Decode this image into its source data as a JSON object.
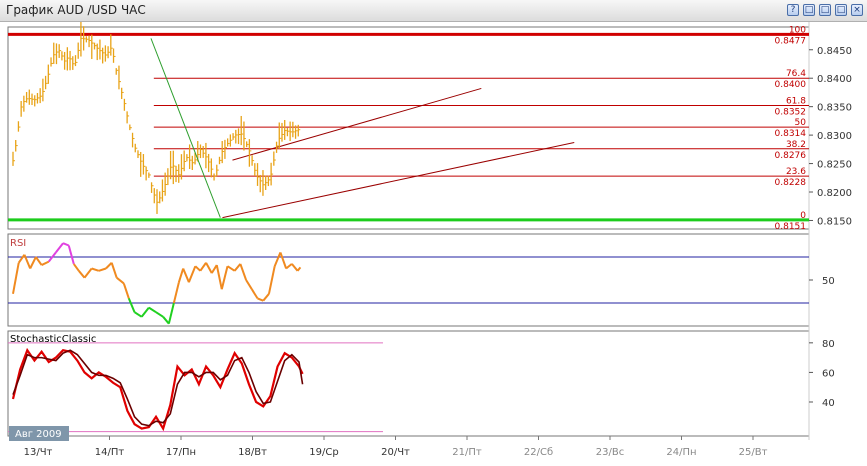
{
  "window": {
    "title": "График AUD /USD  ЧАС",
    "buttons": [
      "?",
      "□",
      "□",
      "□",
      "×"
    ]
  },
  "colors": {
    "price": "#e8a317",
    "fib": "#c00000",
    "channel": "#9a0000",
    "trend": "#2a9d2a",
    "rsi": "#f08a20",
    "rsi_high": "#e040e0",
    "rsi_low": "#20d020",
    "stoch_k": "#e00000",
    "stoch_d": "#6a0000",
    "bands": "#e070c0",
    "rsi_lines": "#2020a0"
  },
  "chart_data": [
    {
      "type": "line",
      "panel": "price",
      "series_style": "bars",
      "y_ticks": [
        "0.8450",
        "0.8400",
        "0.8350",
        "0.8300",
        "0.8250",
        "0.8200",
        "0.8150"
      ],
      "ylim": [
        0.8135,
        0.849
      ],
      "x_tick_labels": [
        "13/Чт",
        "14/Пт",
        "17/Пн",
        "18/Вт",
        "19/Ср",
        "20/Чт",
        "21/Пт",
        "22/Сб",
        "23/Вс",
        "24/Пн",
        "25/Вт"
      ],
      "x_future_from": 6,
      "price_path": [
        [
          0,
          0.8255
        ],
        [
          0.05,
          0.829
        ],
        [
          0.12,
          0.8355
        ],
        [
          0.2,
          0.8365
        ],
        [
          0.3,
          0.8362
        ],
        [
          0.4,
          0.837
        ],
        [
          0.48,
          0.84
        ],
        [
          0.56,
          0.844
        ],
        [
          0.64,
          0.845
        ],
        [
          0.72,
          0.843
        ],
        [
          0.78,
          0.8438
        ],
        [
          0.86,
          0.842
        ],
        [
          0.95,
          0.847
        ],
        [
          1.05,
          0.8468
        ],
        [
          1.2,
          0.845
        ],
        [
          1.3,
          0.844
        ],
        [
          1.38,
          0.8455
        ],
        [
          1.45,
          0.841
        ],
        [
          1.55,
          0.836
        ],
        [
          1.62,
          0.832
        ],
        [
          1.7,
          0.828
        ],
        [
          1.8,
          0.825
        ],
        [
          1.9,
          0.823
        ],
        [
          1.96,
          0.82
        ],
        [
          2.02,
          0.818
        ],
        [
          2.12,
          0.821
        ],
        [
          2.22,
          0.825
        ],
        [
          2.32,
          0.823
        ],
        [
          2.42,
          0.8262
        ],
        [
          2.52,
          0.825
        ],
        [
          2.62,
          0.8275
        ],
        [
          2.72,
          0.8258
        ],
        [
          2.82,
          0.8225
        ],
        [
          2.92,
          0.827
        ],
        [
          3.0,
          0.8285
        ],
        [
          3.1,
          0.83
        ],
        [
          3.2,
          0.8302
        ],
        [
          3.3,
          0.8275
        ],
        [
          3.4,
          0.823
        ],
        [
          3.5,
          0.8212
        ],
        [
          3.6,
          0.8225
        ],
        [
          3.7,
          0.829
        ],
        [
          3.8,
          0.8308
        ],
        [
          3.9,
          0.8305
        ],
        [
          4.0,
          0.831
        ],
        [
          4.02,
          0.83
        ]
      ],
      "fibonacci": [
        {
          "level": "100",
          "price": "0.8477",
          "value": 0.8477
        },
        {
          "level": "76.4",
          "price": "0.8400",
          "value": 0.84
        },
        {
          "level": "61.8",
          "price": "0.8352",
          "value": 0.8352
        },
        {
          "level": "50",
          "price": "0.8314",
          "value": 0.8314
        },
        {
          "level": "38.2",
          "price": "0.8276",
          "value": 0.8276
        },
        {
          "level": "23.6",
          "price": "0.8228",
          "value": 0.8228
        },
        {
          "level": "0",
          "price": "0.8151",
          "value": 0.8151
        }
      ],
      "fib_start_x": 1.62,
      "trendline": [
        [
          1.58,
          0.847
        ],
        [
          2.55,
          0.8155
        ]
      ],
      "channel": [
        [
          [
            2.72,
            0.8256
          ],
          [
            6.2,
            0.8382
          ]
        ],
        [
          [
            2.58,
            0.8155
          ],
          [
            7.5,
            0.8287
          ]
        ]
      ]
    },
    {
      "type": "line",
      "panel": "indicator",
      "name": "RSI",
      "y_tick": "50",
      "ylim": [
        10,
        90
      ],
      "levels": [
        70,
        30
      ],
      "values": [
        [
          0,
          38
        ],
        [
          0.08,
          65
        ],
        [
          0.16,
          72
        ],
        [
          0.24,
          60
        ],
        [
          0.32,
          70
        ],
        [
          0.4,
          63
        ],
        [
          0.5,
          66
        ],
        [
          0.6,
          74
        ],
        [
          0.7,
          82
        ],
        [
          0.78,
          80
        ],
        [
          0.85,
          64
        ],
        [
          0.92,
          58
        ],
        [
          1.0,
          52
        ],
        [
          1.1,
          60
        ],
        [
          1.2,
          58
        ],
        [
          1.3,
          60
        ],
        [
          1.38,
          65
        ],
        [
          1.45,
          52
        ],
        [
          1.55,
          47
        ],
        [
          1.62,
          34
        ],
        [
          1.7,
          22
        ],
        [
          1.8,
          18
        ],
        [
          1.9,
          26
        ],
        [
          2.0,
          22
        ],
        [
          2.1,
          18
        ],
        [
          2.18,
          12
        ],
        [
          2.25,
          30
        ],
        [
          2.32,
          48
        ],
        [
          2.38,
          60
        ],
        [
          2.46,
          48
        ],
        [
          2.55,
          62
        ],
        [
          2.62,
          58
        ],
        [
          2.7,
          65
        ],
        [
          2.78,
          56
        ],
        [
          2.85,
          63
        ],
        [
          2.92,
          42
        ],
        [
          3.0,
          62
        ],
        [
          3.1,
          58
        ],
        [
          3.18,
          64
        ],
        [
          3.26,
          50
        ],
        [
          3.34,
          42
        ],
        [
          3.42,
          34
        ],
        [
          3.5,
          32
        ],
        [
          3.58,
          38
        ],
        [
          3.66,
          62
        ],
        [
          3.74,
          74
        ],
        [
          3.82,
          60
        ],
        [
          3.9,
          64
        ],
        [
          3.98,
          58
        ],
        [
          4.02,
          61
        ]
      ]
    },
    {
      "type": "line",
      "panel": "indicator",
      "name": "StochasticClassic",
      "y_ticks": [
        "80",
        "60",
        "40"
      ],
      "ylim": [
        17,
        88
      ],
      "levels": [
        80,
        20
      ],
      "series": [
        {
          "values": [
            [
              0,
              42
            ],
            [
              0.1,
              62
            ],
            [
              0.2,
              75
            ],
            [
              0.3,
              68
            ],
            [
              0.4,
              74
            ],
            [
              0.5,
              67
            ],
            [
              0.6,
              70
            ],
            [
              0.7,
              75
            ],
            [
              0.8,
              74
            ],
            [
              0.9,
              68
            ],
            [
              1.0,
              60
            ],
            [
              1.1,
              56
            ],
            [
              1.2,
              60
            ],
            [
              1.3,
              57
            ],
            [
              1.4,
              53
            ],
            [
              1.5,
              50
            ],
            [
              1.6,
              34
            ],
            [
              1.7,
              25
            ],
            [
              1.8,
              22
            ],
            [
              1.9,
              23
            ],
            [
              2.0,
              30
            ],
            [
              2.1,
              22
            ],
            [
              2.2,
              38
            ],
            [
              2.3,
              64
            ],
            [
              2.4,
              58
            ],
            [
              2.5,
              62
            ],
            [
              2.6,
              52
            ],
            [
              2.7,
              64
            ],
            [
              2.8,
              58
            ],
            [
              2.9,
              50
            ],
            [
              3.0,
              62
            ],
            [
              3.1,
              73
            ],
            [
              3.2,
              66
            ],
            [
              3.3,
              52
            ],
            [
              3.4,
              40
            ],
            [
              3.5,
              37
            ],
            [
              3.6,
              44
            ],
            [
              3.7,
              64
            ],
            [
              3.8,
              73
            ],
            [
              3.9,
              70
            ],
            [
              4.0,
              64
            ],
            [
              4.05,
              59
            ]
          ]
        },
        {
          "values": [
            [
              0,
              45
            ],
            [
              0.1,
              58
            ],
            [
              0.2,
              72
            ],
            [
              0.3,
              70
            ],
            [
              0.4,
              70
            ],
            [
              0.5,
              69
            ],
            [
              0.6,
              68
            ],
            [
              0.7,
              73
            ],
            [
              0.8,
              75
            ],
            [
              0.9,
              72
            ],
            [
              1.0,
              66
            ],
            [
              1.1,
              60
            ],
            [
              1.2,
              58
            ],
            [
              1.3,
              58
            ],
            [
              1.4,
              56
            ],
            [
              1.5,
              53
            ],
            [
              1.6,
              42
            ],
            [
              1.7,
              30
            ],
            [
              1.8,
              25
            ],
            [
              1.9,
              24
            ],
            [
              2.0,
              27
            ],
            [
              2.1,
              26
            ],
            [
              2.2,
              32
            ],
            [
              2.3,
              52
            ],
            [
              2.4,
              60
            ],
            [
              2.5,
              60
            ],
            [
              2.6,
              57
            ],
            [
              2.7,
              60
            ],
            [
              2.8,
              60
            ],
            [
              2.9,
              55
            ],
            [
              3.0,
              58
            ],
            [
              3.1,
              68
            ],
            [
              3.2,
              70
            ],
            [
              3.3,
              60
            ],
            [
              3.4,
              47
            ],
            [
              3.5,
              39
            ],
            [
              3.6,
              40
            ],
            [
              3.7,
              54
            ],
            [
              3.8,
              68
            ],
            [
              3.9,
              72
            ],
            [
              4.0,
              67
            ],
            [
              4.05,
              52
            ]
          ]
        }
      ]
    }
  ],
  "date_badge": "Авг 2009"
}
